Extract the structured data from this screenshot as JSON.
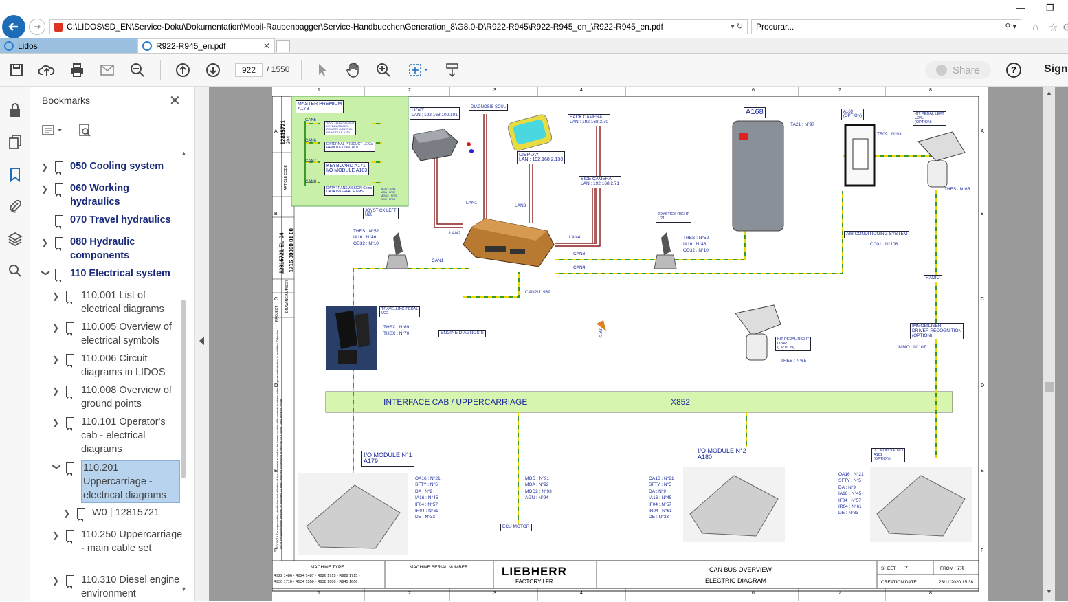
{
  "browser": {
    "url": "C:\\LIDOS\\SD_EN\\Service-Doku\\Dokumentation\\Mobil-Raupenbagger\\Service-Handbuecher\\Generation_8\\G8.0-D\\R922-R945\\R922-R945_en_\\R922-R945_en.pdf",
    "search_placeholder": "Procurar...",
    "tabs": [
      {
        "label": "Lidos"
      },
      {
        "label": "R922-R945_en.pdf"
      }
    ]
  },
  "toolbar": {
    "page_current": "922",
    "page_total": "/ 1550",
    "share_label": "Share",
    "help_label": "?",
    "sign_label": "Sign"
  },
  "bookmarks": {
    "title": "Bookmarks",
    "items": [
      {
        "label": "050 Cooling system"
      },
      {
        "label": "060 Working hydraulics"
      },
      {
        "label": "070 Travel hydraulics"
      },
      {
        "label": "080 Hydraulic components"
      },
      {
        "label": "110 Electrical system"
      },
      {
        "label": "110.001 List of electrical diagrams"
      },
      {
        "label": "110.005 Overview of electrical symbols"
      },
      {
        "label": "110.006 Circuit diagrams in LIDOS"
      },
      {
        "label": "110.008 Overview of ground points"
      },
      {
        "label": "110.101 Operator's cab - electrical diagrams"
      },
      {
        "label": "110.201 Uppercarriage - electrical diagrams"
      },
      {
        "label": "W0 | 12815721"
      },
      {
        "label": "110.250 Uppercarriage - main cable set"
      },
      {
        "label": "110.310 Diesel engine environment"
      }
    ]
  },
  "diagram": {
    "col_numbers": [
      "1",
      "2",
      "3",
      "4",
      "6",
      "7",
      "8"
    ],
    "row_letters": [
      "A",
      "B",
      "C",
      "D",
      "E",
      "F"
    ],
    "side_article": "12815721",
    "side_rev": "204",
    "side_article_label": "ARTICLE CODE",
    "side_drawing": "12815721-EL-04",
    "side_drawing_no": "1716 00090 01 00",
    "side_drawing_label": "DRAWING NUMBER",
    "side_project_label": "PROJECT",
    "master": {
      "title": "MASTER PREMIUM\nA178",
      "can5": "CAN5",
      "can6": "CAN6",
      "can7": "CAN7",
      "can8": "CAN8",
      "can5_box": "TOOL MANAGEMENT\nKEYBOARD A170\nREMOTE CONTROL\nI/O MODULE A182",
      "can6_box": "EXTERNAL PRODUCT LEICA\nREMOTE CONTROL",
      "can7_box": "KEYBOARD A171\nI/O MODULE A183",
      "can8_box": "DATA TRANSMISSION China\nDATA INTERFACE FMS",
      "can8_side": "MOD : N°91\nMOA : N°92\nMOD2 : N°93\nAGN : N°94"
    },
    "lidat": "LIDAT\nLAN : 192.168.100.101",
    "diag_scul": "DIAGNOSIS SCUL",
    "display": "DISPLAY\nLAN : 192.168.2.130",
    "back_camera": "BACK CAMERA\nLAN : 192.168.2.70",
    "side_camera": "SIDE CAMERA\nLAN : 192.168.2.71",
    "a168": "A168",
    "ta21": "TA21 : N°97",
    "a169": "A169\n(OPTION)",
    "tb09": "TB09 : N°93",
    "kit_left": "KIT PEDAL LEFT\nU24L\n(OPTION)",
    "thes65a": "THES : N°65",
    "joy_left": "JOYSTICK LEFT\nU20",
    "joy_left_vals": "THES : N°52\nIA16 : N°46\nOD32 : N°10",
    "joy_right": "JOYSTICK RIGHT\nU21",
    "joy_right_vals": "THES : N°52\nIA16 : N°46\nOD32 : N°10",
    "air_cond": "AIR CONDITIONING SYSTEM",
    "cc01": "CC01 : N°106",
    "radio": "RADIO",
    "lan1": "LAN1",
    "lan2": "LAN2",
    "lan3": "LAN3",
    "lan4": "LAN4",
    "can1": "CAN1",
    "can3": "CAN3",
    "can4": "CAN4",
    "can2": "CAN2/J1939",
    "travel_pedal": "TRAVELLING PEDAL\nU22",
    "travel_vals": "THSX : N°69\nTHSX : N°70",
    "engine_diag": "ENGINE DIAGNOSIS",
    "kit_right": "KIT PEDAL RIGHT\nU24R\n(OPTION)",
    "thes65b": "THES : N°65",
    "immo": "IMMOBILISER\nDRIVER RECOGNITION\n(OPTION)",
    "immo_val": "IMMO : N°107",
    "interface": "INTERFACE CAB / UPPERCARRIAGE",
    "x852": "X852",
    "io1": "I/O MODULE N°1\nA179",
    "io1_vals": "OA16 : N°21\nSFTY : N°5\nDA : N°9\nIA16 : N°45\nIF04 : N°57\nIR04 : N°61\nDE : N°33",
    "mod_vals": "MOD : N°91\nMOA : N°92\nMOD2 : N°93\nAGN : N°94",
    "ecu_motor": "ECU MOTOR",
    "io2": "I/O MODULE N°2\nA180",
    "io2_vals": "OA16 : N°21\nSFTY : N°5\nDA : N°9\nIA16 : N°45\nIF04 : N°57\nIR04 : N°61\nDE : N°33",
    "io3": "I/O MODULE N°3\nA181\n(OPTION)",
    "io3_vals": "OA16 : N°21\nSFTY : N°5\nDA : N°9\nIA16 : N°45\nIF04 : N°57\nIR04 : N°61\nDE : N°33",
    "note_vertical": "ISO 16016  The reproduction, distribution and utilization of this document as well as the communication of its contents to others without express authorization is prohibited. Offenders will be held liable for the payment of damages. All rights reserved in the event of the grant of a patent, utility model or design.",
    "title_block": {
      "machine_type_label": "MACHINE TYPE",
      "machine_types": "R922 1486 - R924 1487 - R926 1715 - R928 1715 -\nR930 1716 - R934 1550 - R938 1650 - R945 1666",
      "serial_label": "MACHINE SERIAL NUMBER",
      "brand": "LIEBHERR",
      "factory": "FACTORY LFR",
      "title1": "CAN BUS OVERVIEW",
      "title2": "ELECTRIC DIAGRAM",
      "sheet_label": "SHEET :",
      "sheet_val": "7",
      "from_label": "FROM :",
      "from_val": "73",
      "date_label": "CREATION DATE:",
      "date_val": "23/11/2020  15:38"
    },
    "rotated_mark": "/5.82"
  },
  "colors": {
    "accent_blue": "#1e6bb8",
    "bookmark_text": "#1a2a7a",
    "selection": "#b8d3ee",
    "green_box": "#c8f0a8",
    "interface_bar": "#d8f5b0",
    "wire_green": "#3a9a2a",
    "wire_yellow": "#e8d800",
    "wire_red": "#8a1a1a"
  }
}
